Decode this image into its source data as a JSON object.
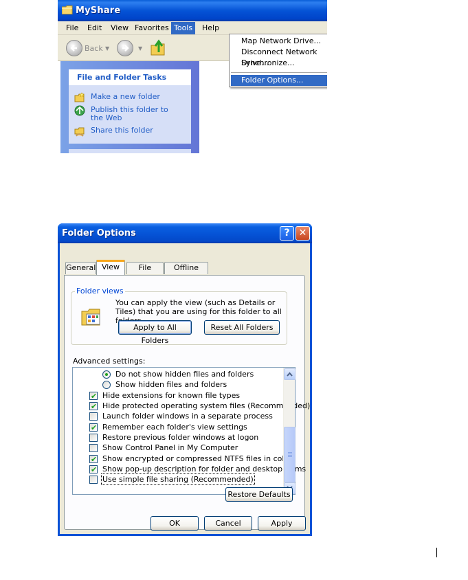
{
  "explorer": {
    "title": "MyShare",
    "menu": [
      "File",
      "Edit",
      "View",
      "Favorites",
      "Tools",
      "Help"
    ],
    "toolbar": {
      "back_label": "Back"
    },
    "task_pane": {
      "header": "File and Folder Tasks",
      "items": [
        "Make a new folder",
        "Publish this folder to the Web",
        "Share this folder"
      ]
    },
    "tools_menu": {
      "items": [
        "Map Network Drive...",
        "Disconnect Network Drive...",
        "Synchronize...",
        "Folder Options..."
      ],
      "selected": "Folder Options..."
    }
  },
  "dialog": {
    "title": "Folder Options",
    "title_buttons": {
      "help": "?",
      "close": "✕"
    },
    "tabs": [
      "General",
      "View",
      "File Types",
      "Offline Files"
    ],
    "active_tab": "View",
    "folder_views": {
      "legend": "Folder views",
      "description": "You can apply the view (such as Details or Tiles) that you are using for this folder to all folders.",
      "apply_button": "Apply to All Folders",
      "reset_button": "Reset All Folders"
    },
    "advanced_label": "Advanced settings:",
    "advanced_items": [
      {
        "type": "radio",
        "label": "Do not show hidden files and folders",
        "checked": true
      },
      {
        "type": "radio",
        "label": "Show hidden files and folders",
        "checked": false
      },
      {
        "type": "checkbox",
        "label": "Hide extensions for known file types",
        "checked": true
      },
      {
        "type": "checkbox",
        "label": "Hide protected operating system files (Recommended)",
        "checked": true
      },
      {
        "type": "checkbox",
        "label": "Launch folder windows in a separate process",
        "checked": false
      },
      {
        "type": "checkbox",
        "label": "Remember each folder's view settings",
        "checked": true
      },
      {
        "type": "checkbox",
        "label": "Restore previous folder windows at logon",
        "checked": false
      },
      {
        "type": "checkbox",
        "label": "Show Control Panel in My Computer",
        "checked": false
      },
      {
        "type": "checkbox",
        "label": "Show encrypted or compressed NTFS files in color",
        "checked": true
      },
      {
        "type": "checkbox",
        "label": "Show pop-up description for folder and desktop items",
        "checked": true
      },
      {
        "type": "checkbox",
        "label": "Use simple file sharing (Recommended)",
        "checked": false,
        "focused": true
      }
    ],
    "restore_defaults": "Restore Defaults",
    "buttons": {
      "ok": "OK",
      "cancel": "Cancel",
      "apply": "Apply"
    }
  },
  "colors": {
    "xp_blue": "#0553d6",
    "menu_highlight": "#316ac5",
    "task_link": "#215dc6",
    "check_green": "#21a121",
    "dialog_bg": "#ece9d8"
  }
}
